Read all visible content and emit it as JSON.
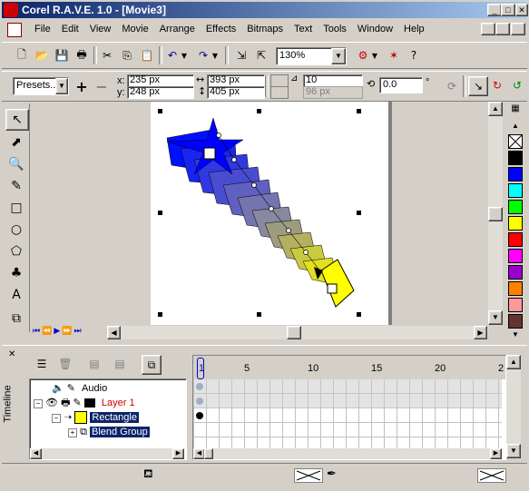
{
  "titlebar": {
    "title": "Corel R.A.V.E. 1.0 - [Movie3]",
    "min": "_",
    "max": "□",
    "close": "✕"
  },
  "menu": {
    "items": [
      {
        "label": "File"
      },
      {
        "label": "Edit"
      },
      {
        "label": "View"
      },
      {
        "label": "Movie"
      },
      {
        "label": "Arrange"
      },
      {
        "label": "Effects"
      },
      {
        "label": "Bitmaps"
      },
      {
        "label": "Text"
      },
      {
        "label": "Tools"
      },
      {
        "label": "Window"
      },
      {
        "label": "Help"
      }
    ]
  },
  "toolbar": {
    "zoom": "130%"
  },
  "propbar": {
    "presets": "Presets...",
    "x": "235 px",
    "y": "248 px",
    "x_label": "x:",
    "y_label": "y:",
    "w": "393 px",
    "h": "405 px",
    "steps": "10",
    "spacing": "96 px",
    "rotation": "0.0",
    "degree": "°"
  },
  "timeline": {
    "side_label": "Timeline",
    "ticks": [
      "1",
      "5",
      "10",
      "15",
      "20",
      "2"
    ],
    "rows": [
      {
        "label": "Audio"
      },
      {
        "label": "Layer 1"
      },
      {
        "label": "Rectangle"
      },
      {
        "label": "Blend Group"
      }
    ]
  },
  "colors": {
    "accent_title": "#0a246a",
    "palette": [
      "#000000",
      "#0000ff",
      "#00ffff",
      "#00ff00",
      "#ffff00",
      "#ff0000",
      "#ff00ff",
      "#ff8000",
      "#ff9999",
      "#800000"
    ]
  }
}
